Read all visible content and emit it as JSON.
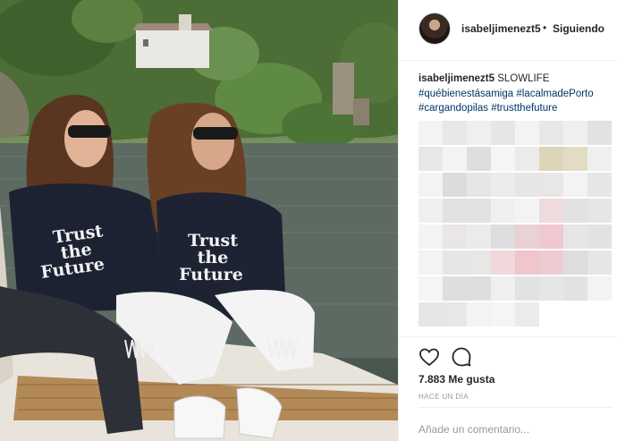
{
  "post": {
    "username": "isabeljimenezt5",
    "separator": "•",
    "follow_status": "Siguiendo",
    "caption": {
      "username": "isabeljimenezt5",
      "text": "SLOWLIFE",
      "hashtags": [
        "#québienestásamiga",
        "#lacalmadePorto",
        "#cargandopilas",
        "#trustthefuture"
      ]
    },
    "likes": "7.883 Me gusta",
    "time": "HACE UN DÍA",
    "comment_placeholder": "Añade un comentario...",
    "shirt_text": [
      "Trust",
      "the",
      "Future"
    ]
  },
  "icons": {
    "like": "heart-icon",
    "comment": "comment-bubble-icon"
  },
  "colors": {
    "hashtag": "#003569",
    "muted": "#999999",
    "border": "#efefef"
  }
}
